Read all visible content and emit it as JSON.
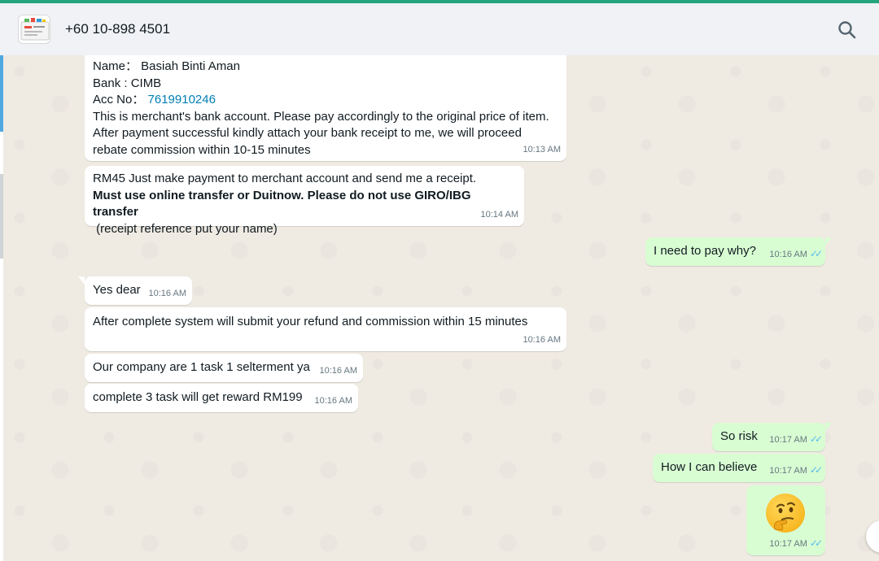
{
  "header": {
    "contact": "+60 10-898 4501",
    "search_icon": "search-icon"
  },
  "messages": [
    {
      "id": "m1",
      "direction": "in",
      "lines": {
        "name_label": "Name： Basiah Binti Aman",
        "bank_label": "Bank : CIMB",
        "acc_label": "Acc No：",
        "acc_value": "7619910246",
        "line4": "This is merchant's bank account. Please pay accordingly to the original price of item.",
        "line5": "After payment successful kindly attach your bank receipt to me, we will proceed",
        "line6": "rebate commission within 10-15 minutes"
      },
      "time": "10:13 AM"
    },
    {
      "id": "m2",
      "direction": "in",
      "lines": {
        "line1": "RM45 Just make payment to merchant account and send me a receipt.",
        "line2": "Must use online transfer or Duitnow. Please do not use GIRO/IBG transfer",
        "line3": " (receipt reference put your name)"
      },
      "time": "10:14 AM"
    },
    {
      "id": "m3",
      "direction": "out",
      "text": "I need to pay why?",
      "time": "10:16 AM"
    },
    {
      "id": "m4",
      "direction": "in",
      "text": "Yes dear",
      "time": "10:16 AM"
    },
    {
      "id": "m5",
      "direction": "in",
      "text": "After complete system will submit your refund and commission within 15 minutes",
      "time": "10:16 AM"
    },
    {
      "id": "m6",
      "direction": "in",
      "text": "Our company are 1 task 1 selterment ya",
      "time": "10:16 AM"
    },
    {
      "id": "m7",
      "direction": "in",
      "text": "complete 3 task will get reward RM199",
      "time": "10:16 AM"
    },
    {
      "id": "m8",
      "direction": "out",
      "text": "So risk",
      "time": "10:17 AM"
    },
    {
      "id": "m9",
      "direction": "out",
      "text": "How I can believe",
      "time": "10:17 AM"
    },
    {
      "id": "m10",
      "direction": "out",
      "emoji": "thinking-face-emoji",
      "time": "10:17 AM"
    }
  ],
  "colors": {
    "accent": "#25a47e",
    "incoming": "#ffffff",
    "outgoing": "#d9fdd3",
    "chat_bg": "#efeae2",
    "read_ticks": "#53bdeb"
  }
}
